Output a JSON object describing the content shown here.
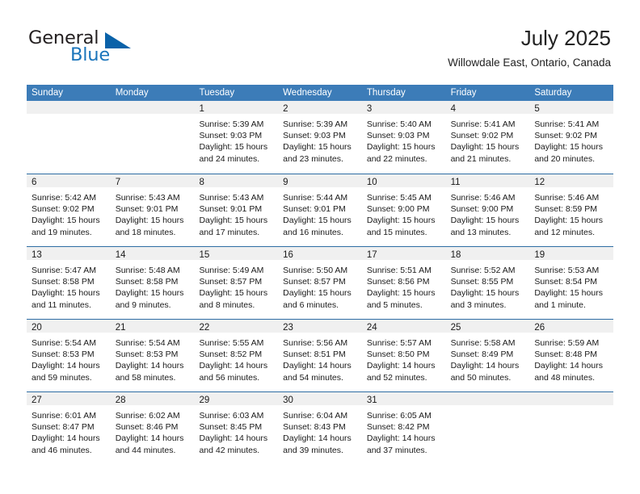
{
  "brand": {
    "name_part1": "General",
    "name_part2": "Blue",
    "accent_color": "#1b75bb",
    "triangle_color": "#0a62a9"
  },
  "header": {
    "title": "July 2025",
    "subtitle": "Willowdale East, Ontario, Canada"
  },
  "theme": {
    "header_band_color": "#3c7cb8",
    "row_divider_color": "#2e6da4",
    "daynum_band_color": "#f0f0f0"
  },
  "weekdays": [
    "Sunday",
    "Monday",
    "Tuesday",
    "Wednesday",
    "Thursday",
    "Friday",
    "Saturday"
  ],
  "weeks": [
    [
      {
        "day": "",
        "empty": true
      },
      {
        "day": "",
        "empty": true
      },
      {
        "day": "1",
        "sunrise": "Sunrise: 5:39 AM",
        "sunset": "Sunset: 9:03 PM",
        "daylight_1": "Daylight: 15 hours",
        "daylight_2": "and 24 minutes."
      },
      {
        "day": "2",
        "sunrise": "Sunrise: 5:39 AM",
        "sunset": "Sunset: 9:03 PM",
        "daylight_1": "Daylight: 15 hours",
        "daylight_2": "and 23 minutes."
      },
      {
        "day": "3",
        "sunrise": "Sunrise: 5:40 AM",
        "sunset": "Sunset: 9:03 PM",
        "daylight_1": "Daylight: 15 hours",
        "daylight_2": "and 22 minutes."
      },
      {
        "day": "4",
        "sunrise": "Sunrise: 5:41 AM",
        "sunset": "Sunset: 9:02 PM",
        "daylight_1": "Daylight: 15 hours",
        "daylight_2": "and 21 minutes."
      },
      {
        "day": "5",
        "sunrise": "Sunrise: 5:41 AM",
        "sunset": "Sunset: 9:02 PM",
        "daylight_1": "Daylight: 15 hours",
        "daylight_2": "and 20 minutes."
      }
    ],
    [
      {
        "day": "6",
        "sunrise": "Sunrise: 5:42 AM",
        "sunset": "Sunset: 9:02 PM",
        "daylight_1": "Daylight: 15 hours",
        "daylight_2": "and 19 minutes."
      },
      {
        "day": "7",
        "sunrise": "Sunrise: 5:43 AM",
        "sunset": "Sunset: 9:01 PM",
        "daylight_1": "Daylight: 15 hours",
        "daylight_2": "and 18 minutes."
      },
      {
        "day": "8",
        "sunrise": "Sunrise: 5:43 AM",
        "sunset": "Sunset: 9:01 PM",
        "daylight_1": "Daylight: 15 hours",
        "daylight_2": "and 17 minutes."
      },
      {
        "day": "9",
        "sunrise": "Sunrise: 5:44 AM",
        "sunset": "Sunset: 9:01 PM",
        "daylight_1": "Daylight: 15 hours",
        "daylight_2": "and 16 minutes."
      },
      {
        "day": "10",
        "sunrise": "Sunrise: 5:45 AM",
        "sunset": "Sunset: 9:00 PM",
        "daylight_1": "Daylight: 15 hours",
        "daylight_2": "and 15 minutes."
      },
      {
        "day": "11",
        "sunrise": "Sunrise: 5:46 AM",
        "sunset": "Sunset: 9:00 PM",
        "daylight_1": "Daylight: 15 hours",
        "daylight_2": "and 13 minutes."
      },
      {
        "day": "12",
        "sunrise": "Sunrise: 5:46 AM",
        "sunset": "Sunset: 8:59 PM",
        "daylight_1": "Daylight: 15 hours",
        "daylight_2": "and 12 minutes."
      }
    ],
    [
      {
        "day": "13",
        "sunrise": "Sunrise: 5:47 AM",
        "sunset": "Sunset: 8:58 PM",
        "daylight_1": "Daylight: 15 hours",
        "daylight_2": "and 11 minutes."
      },
      {
        "day": "14",
        "sunrise": "Sunrise: 5:48 AM",
        "sunset": "Sunset: 8:58 PM",
        "daylight_1": "Daylight: 15 hours",
        "daylight_2": "and 9 minutes."
      },
      {
        "day": "15",
        "sunrise": "Sunrise: 5:49 AM",
        "sunset": "Sunset: 8:57 PM",
        "daylight_1": "Daylight: 15 hours",
        "daylight_2": "and 8 minutes."
      },
      {
        "day": "16",
        "sunrise": "Sunrise: 5:50 AM",
        "sunset": "Sunset: 8:57 PM",
        "daylight_1": "Daylight: 15 hours",
        "daylight_2": "and 6 minutes."
      },
      {
        "day": "17",
        "sunrise": "Sunrise: 5:51 AM",
        "sunset": "Sunset: 8:56 PM",
        "daylight_1": "Daylight: 15 hours",
        "daylight_2": "and 5 minutes."
      },
      {
        "day": "18",
        "sunrise": "Sunrise: 5:52 AM",
        "sunset": "Sunset: 8:55 PM",
        "daylight_1": "Daylight: 15 hours",
        "daylight_2": "and 3 minutes."
      },
      {
        "day": "19",
        "sunrise": "Sunrise: 5:53 AM",
        "sunset": "Sunset: 8:54 PM",
        "daylight_1": "Daylight: 15 hours",
        "daylight_2": "and 1 minute."
      }
    ],
    [
      {
        "day": "20",
        "sunrise": "Sunrise: 5:54 AM",
        "sunset": "Sunset: 8:53 PM",
        "daylight_1": "Daylight: 14 hours",
        "daylight_2": "and 59 minutes."
      },
      {
        "day": "21",
        "sunrise": "Sunrise: 5:54 AM",
        "sunset": "Sunset: 8:53 PM",
        "daylight_1": "Daylight: 14 hours",
        "daylight_2": "and 58 minutes."
      },
      {
        "day": "22",
        "sunrise": "Sunrise: 5:55 AM",
        "sunset": "Sunset: 8:52 PM",
        "daylight_1": "Daylight: 14 hours",
        "daylight_2": "and 56 minutes."
      },
      {
        "day": "23",
        "sunrise": "Sunrise: 5:56 AM",
        "sunset": "Sunset: 8:51 PM",
        "daylight_1": "Daylight: 14 hours",
        "daylight_2": "and 54 minutes."
      },
      {
        "day": "24",
        "sunrise": "Sunrise: 5:57 AM",
        "sunset": "Sunset: 8:50 PM",
        "daylight_1": "Daylight: 14 hours",
        "daylight_2": "and 52 minutes."
      },
      {
        "day": "25",
        "sunrise": "Sunrise: 5:58 AM",
        "sunset": "Sunset: 8:49 PM",
        "daylight_1": "Daylight: 14 hours",
        "daylight_2": "and 50 minutes."
      },
      {
        "day": "26",
        "sunrise": "Sunrise: 5:59 AM",
        "sunset": "Sunset: 8:48 PM",
        "daylight_1": "Daylight: 14 hours",
        "daylight_2": "and 48 minutes."
      }
    ],
    [
      {
        "day": "27",
        "sunrise": "Sunrise: 6:01 AM",
        "sunset": "Sunset: 8:47 PM",
        "daylight_1": "Daylight: 14 hours",
        "daylight_2": "and 46 minutes."
      },
      {
        "day": "28",
        "sunrise": "Sunrise: 6:02 AM",
        "sunset": "Sunset: 8:46 PM",
        "daylight_1": "Daylight: 14 hours",
        "daylight_2": "and 44 minutes."
      },
      {
        "day": "29",
        "sunrise": "Sunrise: 6:03 AM",
        "sunset": "Sunset: 8:45 PM",
        "daylight_1": "Daylight: 14 hours",
        "daylight_2": "and 42 minutes."
      },
      {
        "day": "30",
        "sunrise": "Sunrise: 6:04 AM",
        "sunset": "Sunset: 8:43 PM",
        "daylight_1": "Daylight: 14 hours",
        "daylight_2": "and 39 minutes."
      },
      {
        "day": "31",
        "sunrise": "Sunrise: 6:05 AM",
        "sunset": "Sunset: 8:42 PM",
        "daylight_1": "Daylight: 14 hours",
        "daylight_2": "and 37 minutes."
      },
      {
        "day": "",
        "empty": true
      },
      {
        "day": "",
        "empty": true
      }
    ]
  ]
}
